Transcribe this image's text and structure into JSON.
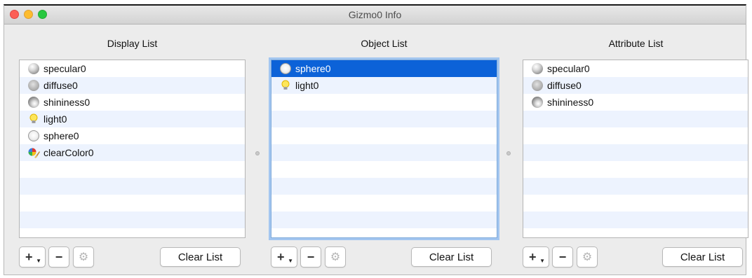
{
  "window": {
    "title": "Gizmo0 Info"
  },
  "panels": [
    {
      "label": "Display List",
      "items": [
        {
          "label": "specular0",
          "icon": "specular-sphere-icon"
        },
        {
          "label": "diffuse0",
          "icon": "diffuse-sphere-icon"
        },
        {
          "label": "shininess0",
          "icon": "shininess-sphere-icon"
        },
        {
          "label": "light0",
          "icon": "light-bulb-icon"
        },
        {
          "label": "sphere0",
          "icon": "sphere-icon"
        },
        {
          "label": "clearColor0",
          "icon": "clear-color-icon"
        }
      ],
      "clear_label": "Clear List"
    },
    {
      "label": "Object List",
      "items": [
        {
          "label": "sphere0",
          "icon": "sphere-icon",
          "selected": true
        },
        {
          "label": "light0",
          "icon": "light-bulb-icon"
        }
      ],
      "clear_label": "Clear List"
    },
    {
      "label": "Attribute List",
      "items": [
        {
          "label": "specular0",
          "icon": "specular-sphere-icon"
        },
        {
          "label": "diffuse0",
          "icon": "diffuse-sphere-icon"
        },
        {
          "label": "shininess0",
          "icon": "shininess-sphere-icon"
        }
      ],
      "clear_label": "Clear List"
    }
  ],
  "buttons": {
    "add": "+",
    "remove": "−",
    "add_menu": "▼",
    "settings": "⚙"
  },
  "colors": {
    "selection": "#0c62d8",
    "focus_ring": "#a3c6f0",
    "alt_row": "#edf3fe"
  }
}
